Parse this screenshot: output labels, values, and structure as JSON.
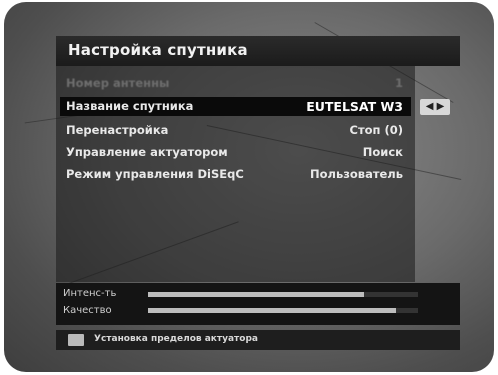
{
  "title": "Настройка спутника",
  "menu": {
    "items": [
      {
        "label": "Номер антенны",
        "value": "1",
        "state": "disabled"
      },
      {
        "label": "Название спутника",
        "value": "EUTELSAT W3",
        "state": "selected"
      },
      {
        "label": "Перенастройка",
        "value": "Стоп (0)",
        "state": "normal"
      },
      {
        "label": "Управление актуатором",
        "value": "Поиск",
        "state": "normal"
      },
      {
        "label": "Режим управления DiSEqC",
        "value": "Пользователь",
        "state": "normal"
      }
    ],
    "selector_arrows": "◀ ▶"
  },
  "meters": {
    "intensity": {
      "label": "Интенс-ть",
      "level": 0.8
    },
    "quality": {
      "label": "Качество",
      "level": 0.92
    }
  },
  "footer": {
    "hint": "Установка пределов актуатора",
    "key_color": "#b9b9b9"
  },
  "colors": {
    "panel": "#1b1b1b",
    "selected_row": "#0a0a0a",
    "text": "#e9e9e9"
  }
}
